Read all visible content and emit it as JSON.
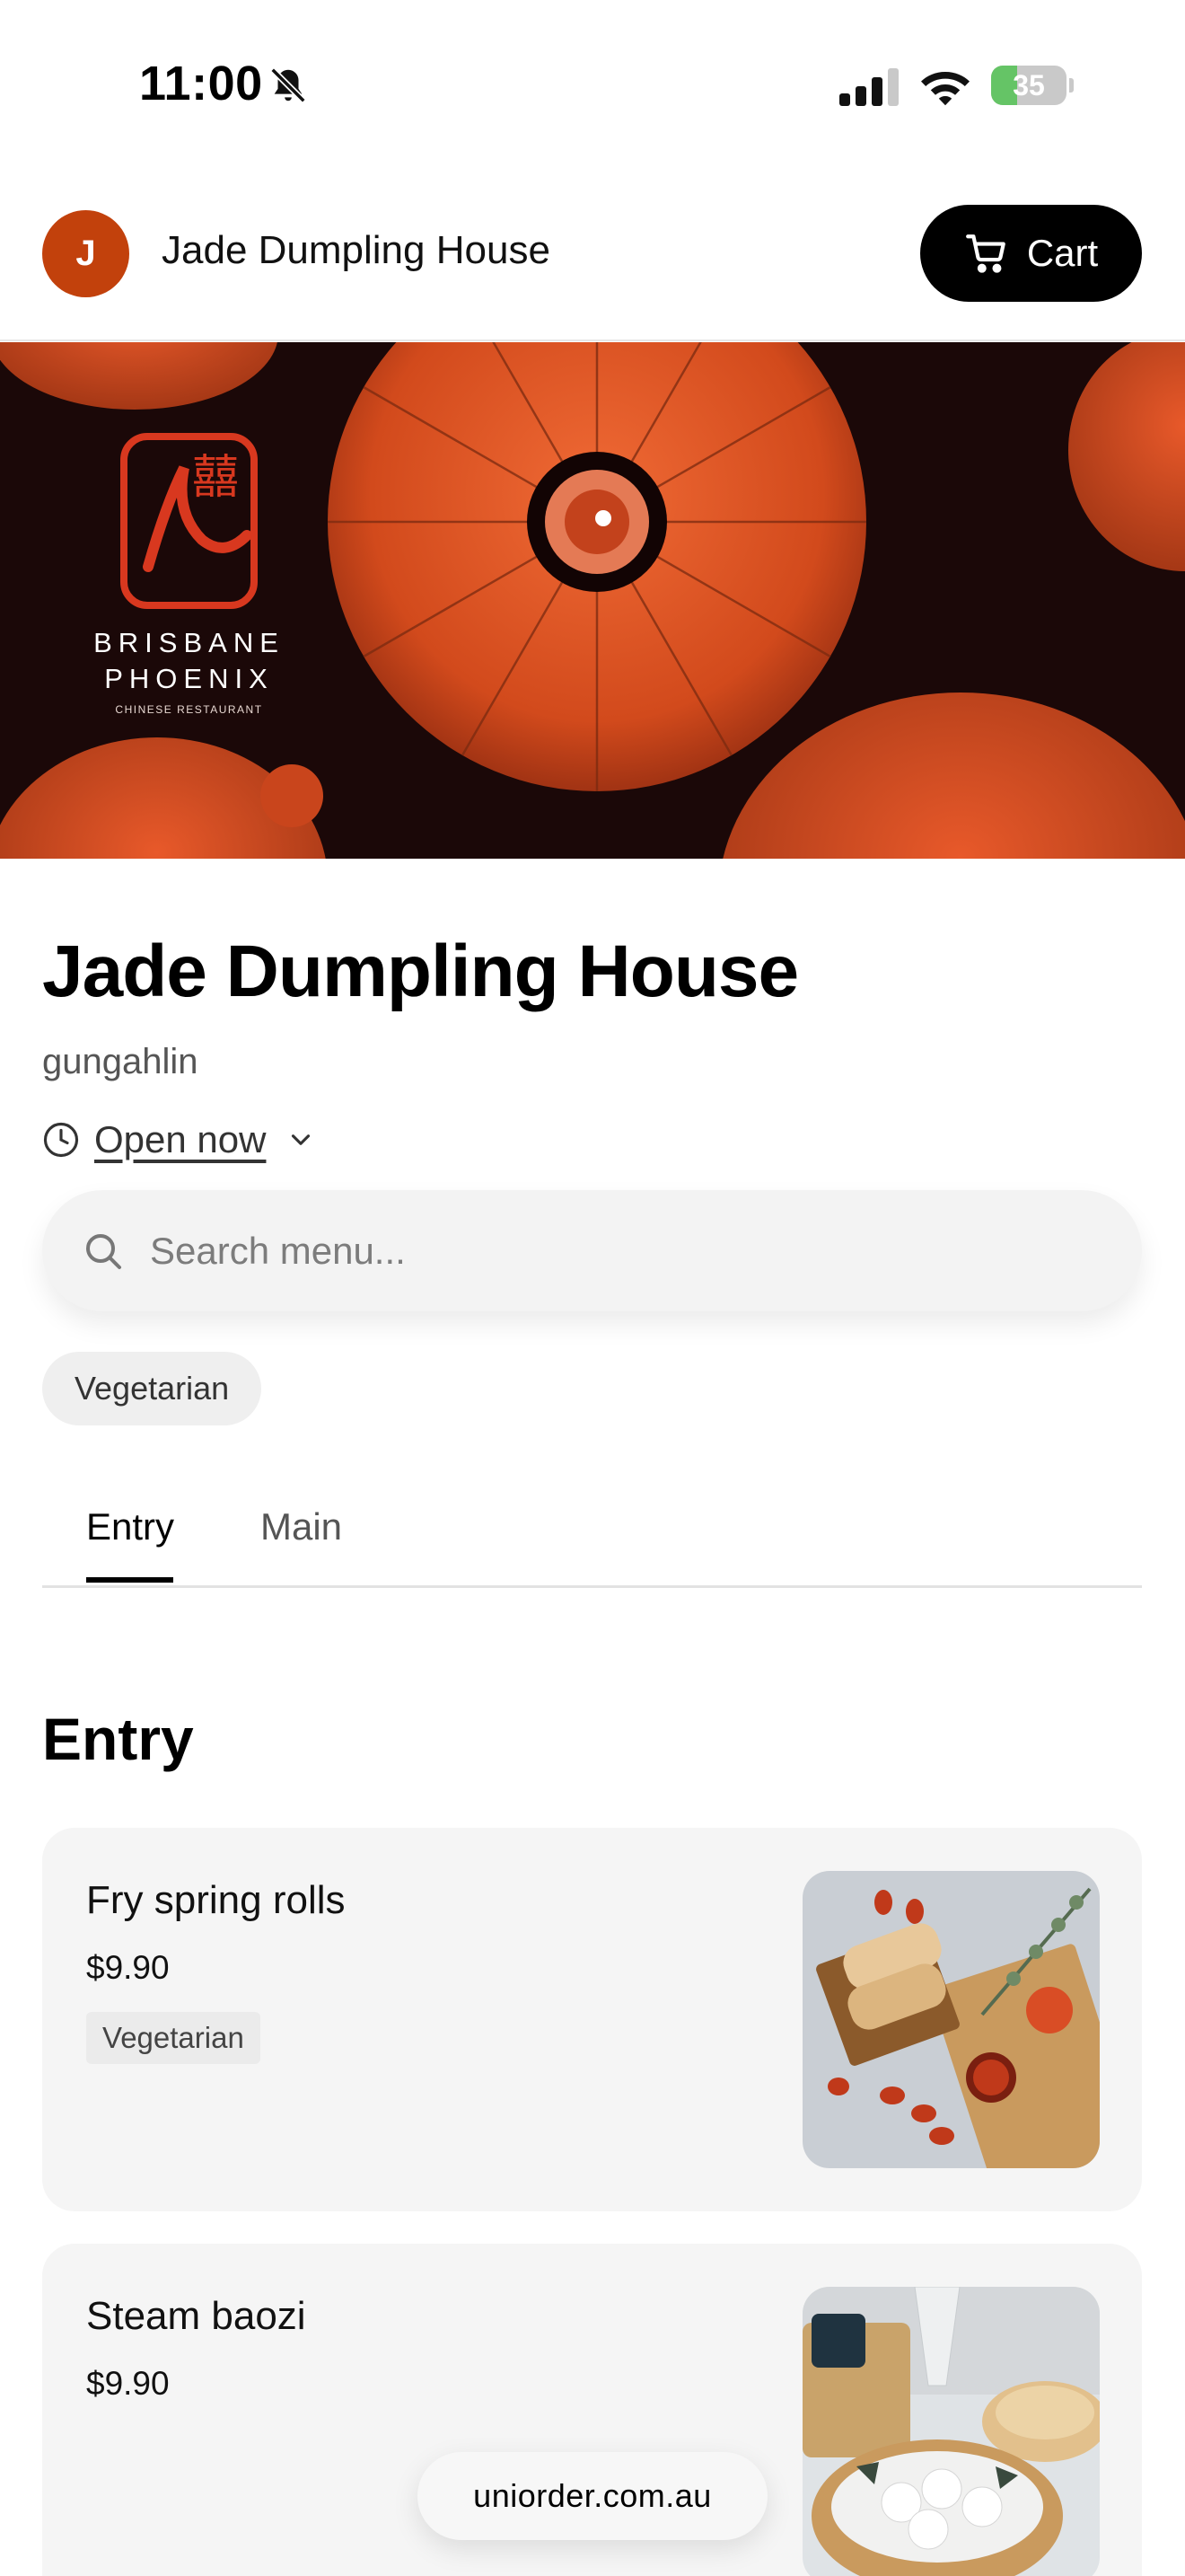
{
  "status_bar": {
    "time": "11:00",
    "battery_percent": 35,
    "battery_label": "35",
    "icons": [
      "bell-slash-icon",
      "cellular-signal-icon",
      "wifi-icon",
      "battery-charging-icon"
    ]
  },
  "header": {
    "avatar_initial": "J",
    "title": "Jade Dumpling House",
    "cart_label": "Cart",
    "cart_icon": "shopping-cart-icon",
    "accent_color": "#c2410c"
  },
  "hero": {
    "brand_line1": "BRISBANE",
    "brand_line2": "PHOENIX",
    "brand_tagline": "CHINESE RESTAURANT",
    "logo_chars": "囍"
  },
  "restaurant": {
    "name": "Jade Dumpling House",
    "location": "gungahlin",
    "hours_status": "Open now",
    "hours_icon": "clock-icon"
  },
  "search": {
    "placeholder": "Search menu...",
    "value": ""
  },
  "filters": [
    "Vegetarian"
  ],
  "tabs": [
    {
      "label": "Entry",
      "active": true
    },
    {
      "label": "Main",
      "active": false
    }
  ],
  "section": {
    "title": "Entry"
  },
  "menu_items": [
    {
      "name": "Fry spring rolls",
      "price": "$9.90",
      "tag": "Vegetarian",
      "photo": "spring-rolls-photo"
    },
    {
      "name": "Steam baozi",
      "price": "$9.90",
      "photo": "baozi-steamer-photo"
    }
  ],
  "footer": {
    "domain": "uniorder.com.au"
  }
}
